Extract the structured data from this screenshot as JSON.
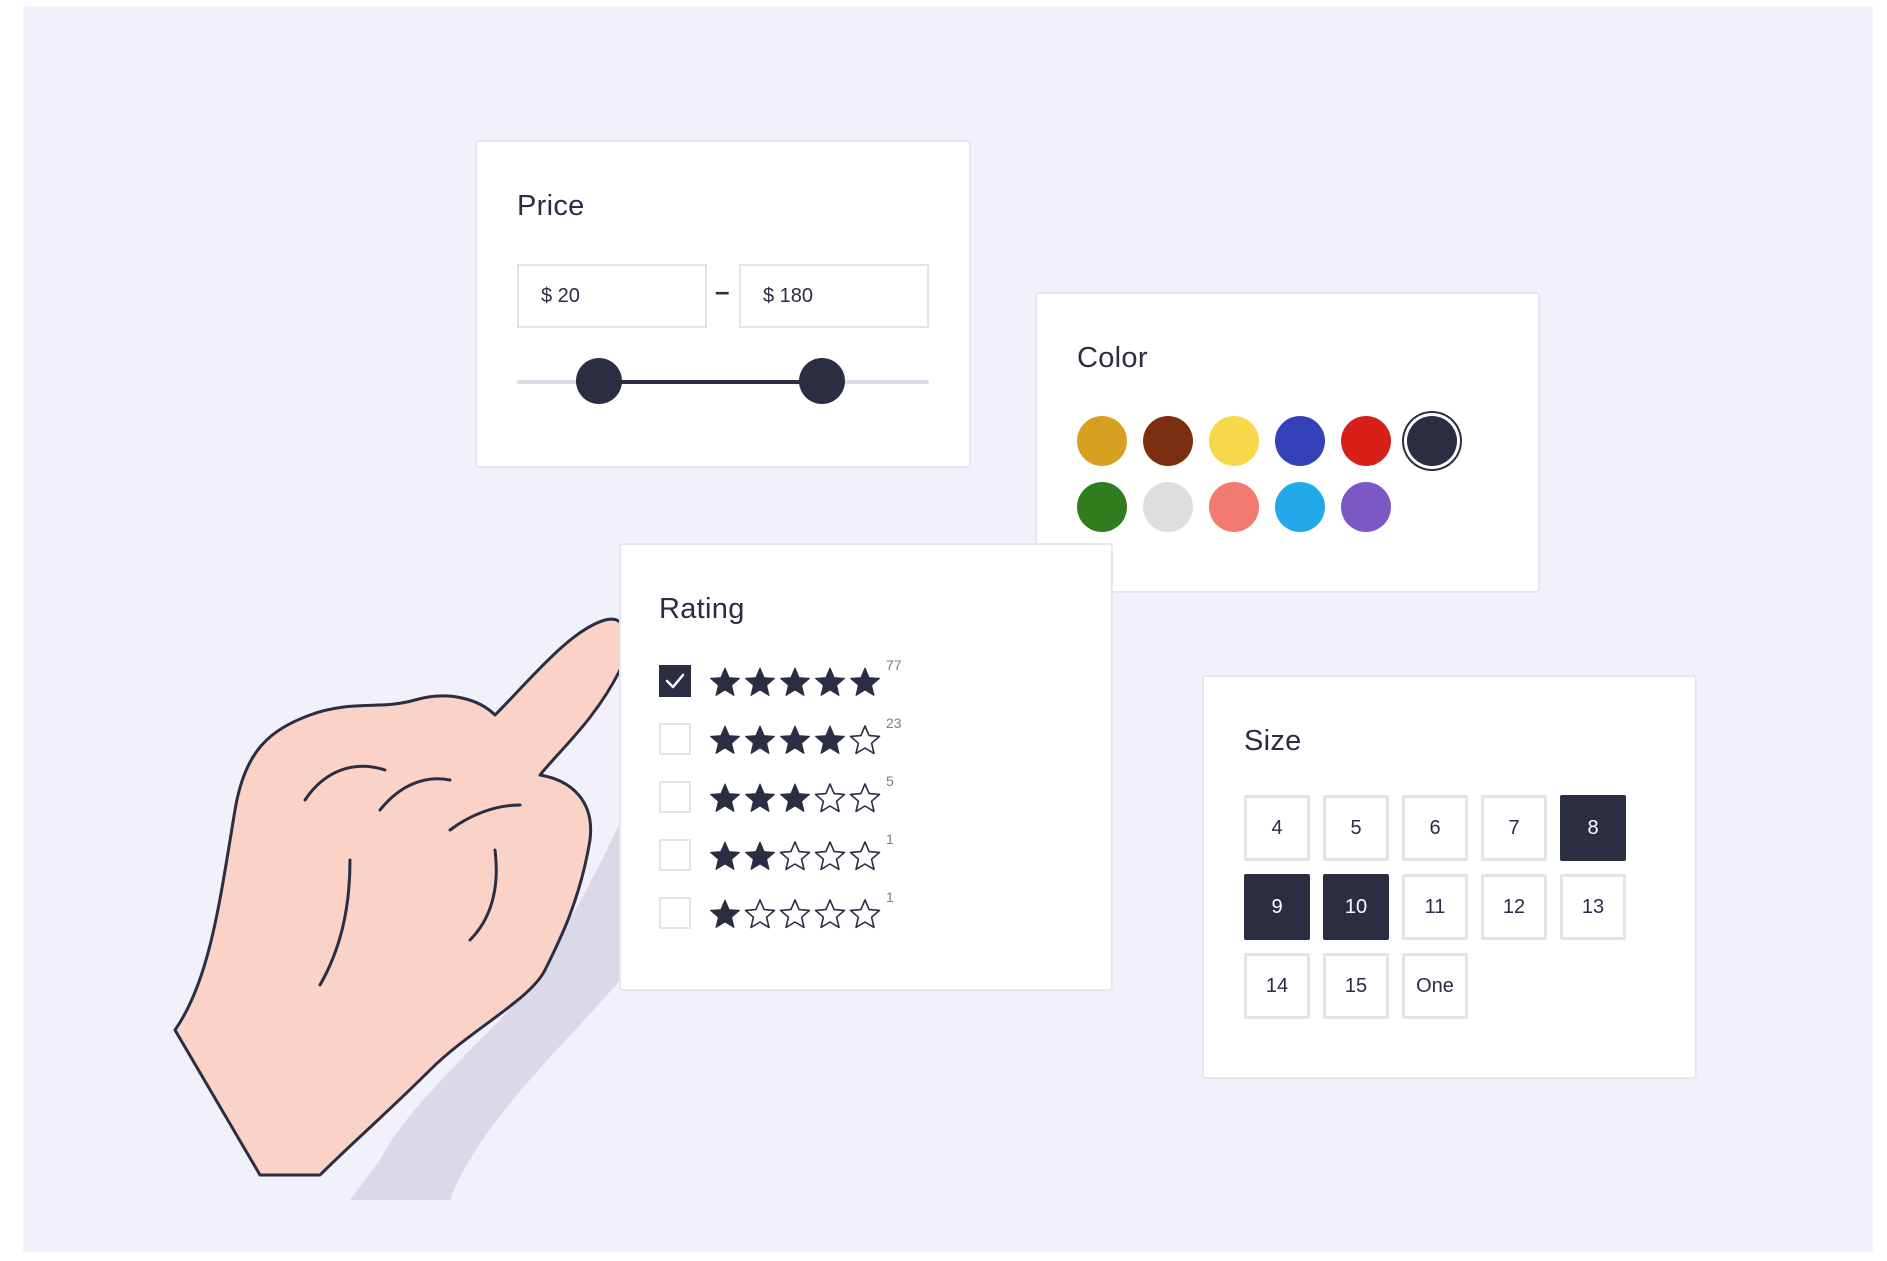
{
  "colors": {
    "background": "#f1f1fc",
    "card": "#ffffff",
    "card_border": "#e6e6f2",
    "ink": "#2b2d42",
    "muted": "#7a7d95",
    "skin": "#fbd3c6",
    "skin_shadow": "#d9d9e8"
  },
  "price": {
    "title": "Price",
    "min_value": "$ 20",
    "max_value": "$ 180",
    "separator": "–",
    "slider_min_fraction": 0.2,
    "slider_max_fraction": 0.74
  },
  "color": {
    "title": "Color",
    "swatches": [
      {
        "name": "mustard",
        "hex": "#d8a021",
        "selected": false
      },
      {
        "name": "brown",
        "hex": "#7c2f10",
        "selected": false
      },
      {
        "name": "yellow",
        "hex": "#f7d84a",
        "selected": false
      },
      {
        "name": "blue",
        "hex": "#3541b8",
        "selected": false
      },
      {
        "name": "red",
        "hex": "#d8201a",
        "selected": false
      },
      {
        "name": "navy",
        "hex": "#2b2d42",
        "selected": true
      },
      {
        "name": "green",
        "hex": "#2f7d1e",
        "selected": false
      },
      {
        "name": "light-gray",
        "hex": "#dedede",
        "selected": false
      },
      {
        "name": "salmon",
        "hex": "#f27a70",
        "selected": false
      },
      {
        "name": "sky-blue",
        "hex": "#21a9ec",
        "selected": false
      },
      {
        "name": "purple",
        "hex": "#7c58c5",
        "selected": false
      }
    ]
  },
  "rating": {
    "title": "Rating",
    "options": [
      {
        "stars": 5,
        "count": "77",
        "checked": true
      },
      {
        "stars": 4,
        "count": "23",
        "checked": false
      },
      {
        "stars": 3,
        "count": "5",
        "checked": false
      },
      {
        "stars": 2,
        "count": "1",
        "checked": false
      },
      {
        "stars": 1,
        "count": "1",
        "checked": false
      }
    ]
  },
  "size": {
    "title": "Size",
    "options": [
      {
        "label": "4",
        "selected": false
      },
      {
        "label": "5",
        "selected": false
      },
      {
        "label": "6",
        "selected": false
      },
      {
        "label": "7",
        "selected": false
      },
      {
        "label": "8",
        "selected": true
      },
      {
        "label": "9",
        "selected": true
      },
      {
        "label": "10",
        "selected": true
      },
      {
        "label": "11",
        "selected": false
      },
      {
        "label": "12",
        "selected": false
      },
      {
        "label": "13",
        "selected": false
      },
      {
        "label": "14",
        "selected": false
      },
      {
        "label": "15",
        "selected": false
      },
      {
        "label": "One",
        "selected": false
      }
    ]
  }
}
